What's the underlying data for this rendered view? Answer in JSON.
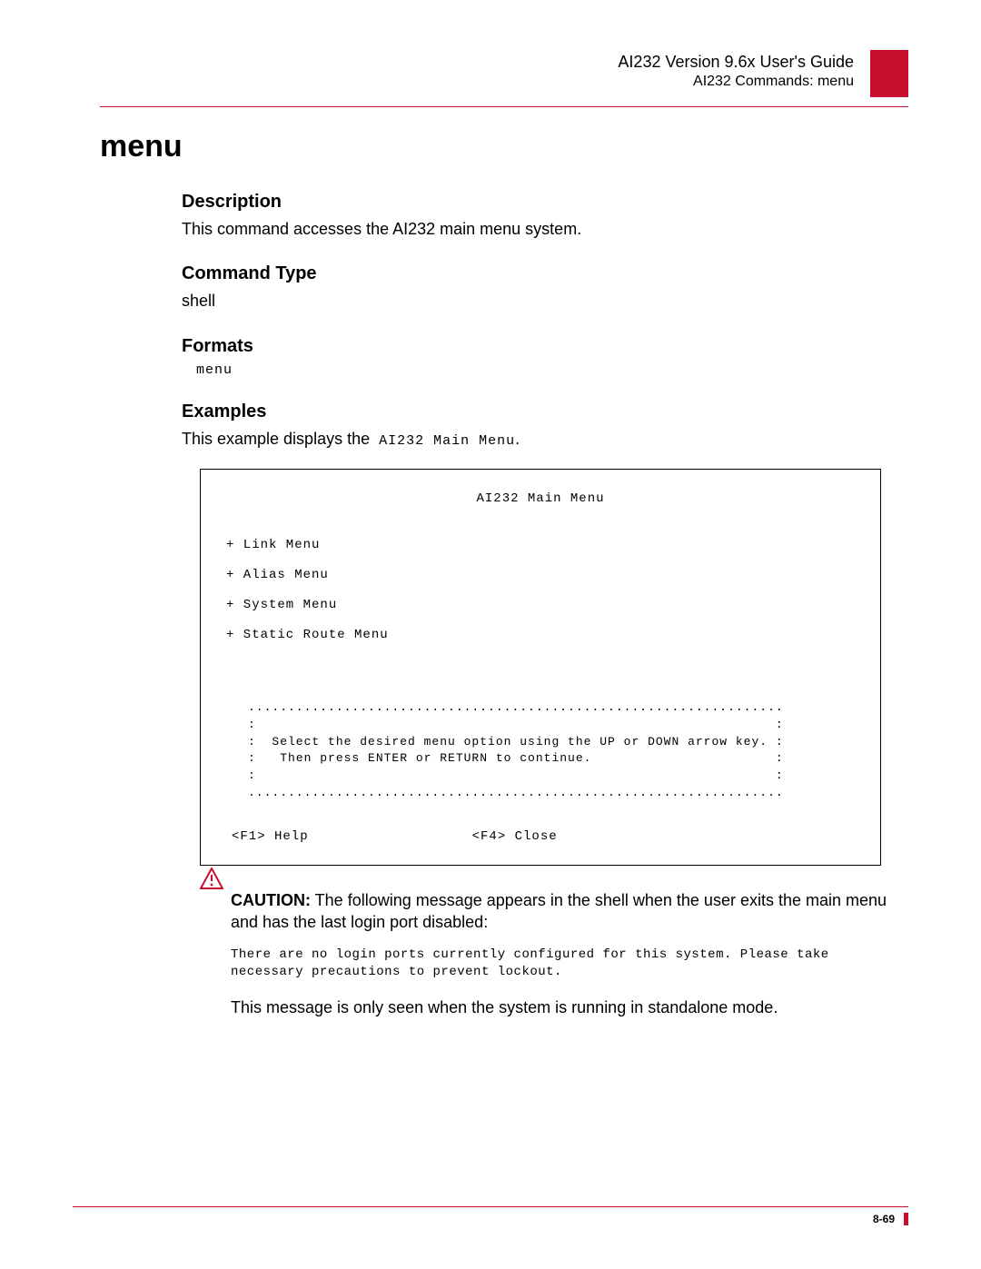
{
  "header": {
    "title": "AI232 Version 9.6x User's Guide",
    "subtitle": "AI232 Commands: menu"
  },
  "command_title": "menu",
  "sections": {
    "description": {
      "heading": "Description",
      "text": "This command accesses the AI232 main menu system."
    },
    "command_type": {
      "heading": "Command Type",
      "value": "shell"
    },
    "formats": {
      "heading": "Formats",
      "value": "menu"
    },
    "examples": {
      "heading": "Examples",
      "intro_prefix": "This example displays the",
      "intro_mono": " AI232 Main Menu",
      "intro_suffix": "."
    }
  },
  "terminal": {
    "title": "AI232 Main Menu",
    "items": [
      "+ Link Menu",
      "+ Alias Menu",
      "+ System Menu",
      "+ Static Route Menu"
    ],
    "instruction": "...................................................................\n:                                                                 :\n:  Select the desired menu option using the UP or DOWN arrow key. :\n:   Then press ENTER or RETURN to continue.                       :\n:                                                                 :\n...................................................................",
    "fn_help": "<F1> Help",
    "fn_close": "<F4> Close"
  },
  "caution": {
    "label": "CAUTION:",
    "text1": " The following message appears in the shell when the user exits the main menu and has the last login port disabled:",
    "mono": "There are no login ports currently configured for this system. Please take necessary precautions to prevent lockout.",
    "text2": "This message is only seen when the system is running in standalone mode."
  },
  "footer": {
    "page": "8-69"
  }
}
